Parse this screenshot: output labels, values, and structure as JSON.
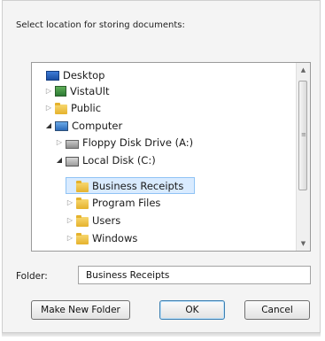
{
  "dialog": {
    "prompt": "Select location for storing documents:",
    "tree": {
      "items": [
        {
          "label": "Desktop",
          "icon": "desktop-icon",
          "expander": ""
        },
        {
          "label": "VistaUlt",
          "icon": "user-folder-icon",
          "expander": "▷"
        },
        {
          "label": "Public",
          "icon": "folder-icon",
          "expander": "▷"
        },
        {
          "label": "Computer",
          "icon": "computer-icon",
          "expander": "◢"
        },
        {
          "label": "Floppy Disk Drive (A:)",
          "icon": "floppy-icon",
          "expander": "▷"
        },
        {
          "label": "Local Disk (C:)",
          "icon": "disk-icon",
          "expander": "◢"
        },
        {
          "label": "Business Receipts",
          "icon": "folder-icon",
          "expander": ""
        },
        {
          "label": "Program Files",
          "icon": "folder-icon",
          "expander": "▷"
        },
        {
          "label": "Users",
          "icon": "folder-icon",
          "expander": "▷"
        },
        {
          "label": "Windows",
          "icon": "folder-icon",
          "expander": "▷"
        }
      ],
      "selected": "Business Receipts"
    },
    "scrollbar": {
      "up": "▲",
      "down": "▼",
      "grip": "≡"
    },
    "folder_label": "Folder:",
    "folder_value": "Business Receipts",
    "buttons": {
      "new_folder": "Make New Folder",
      "ok": "OK",
      "cancel": "Cancel"
    }
  }
}
